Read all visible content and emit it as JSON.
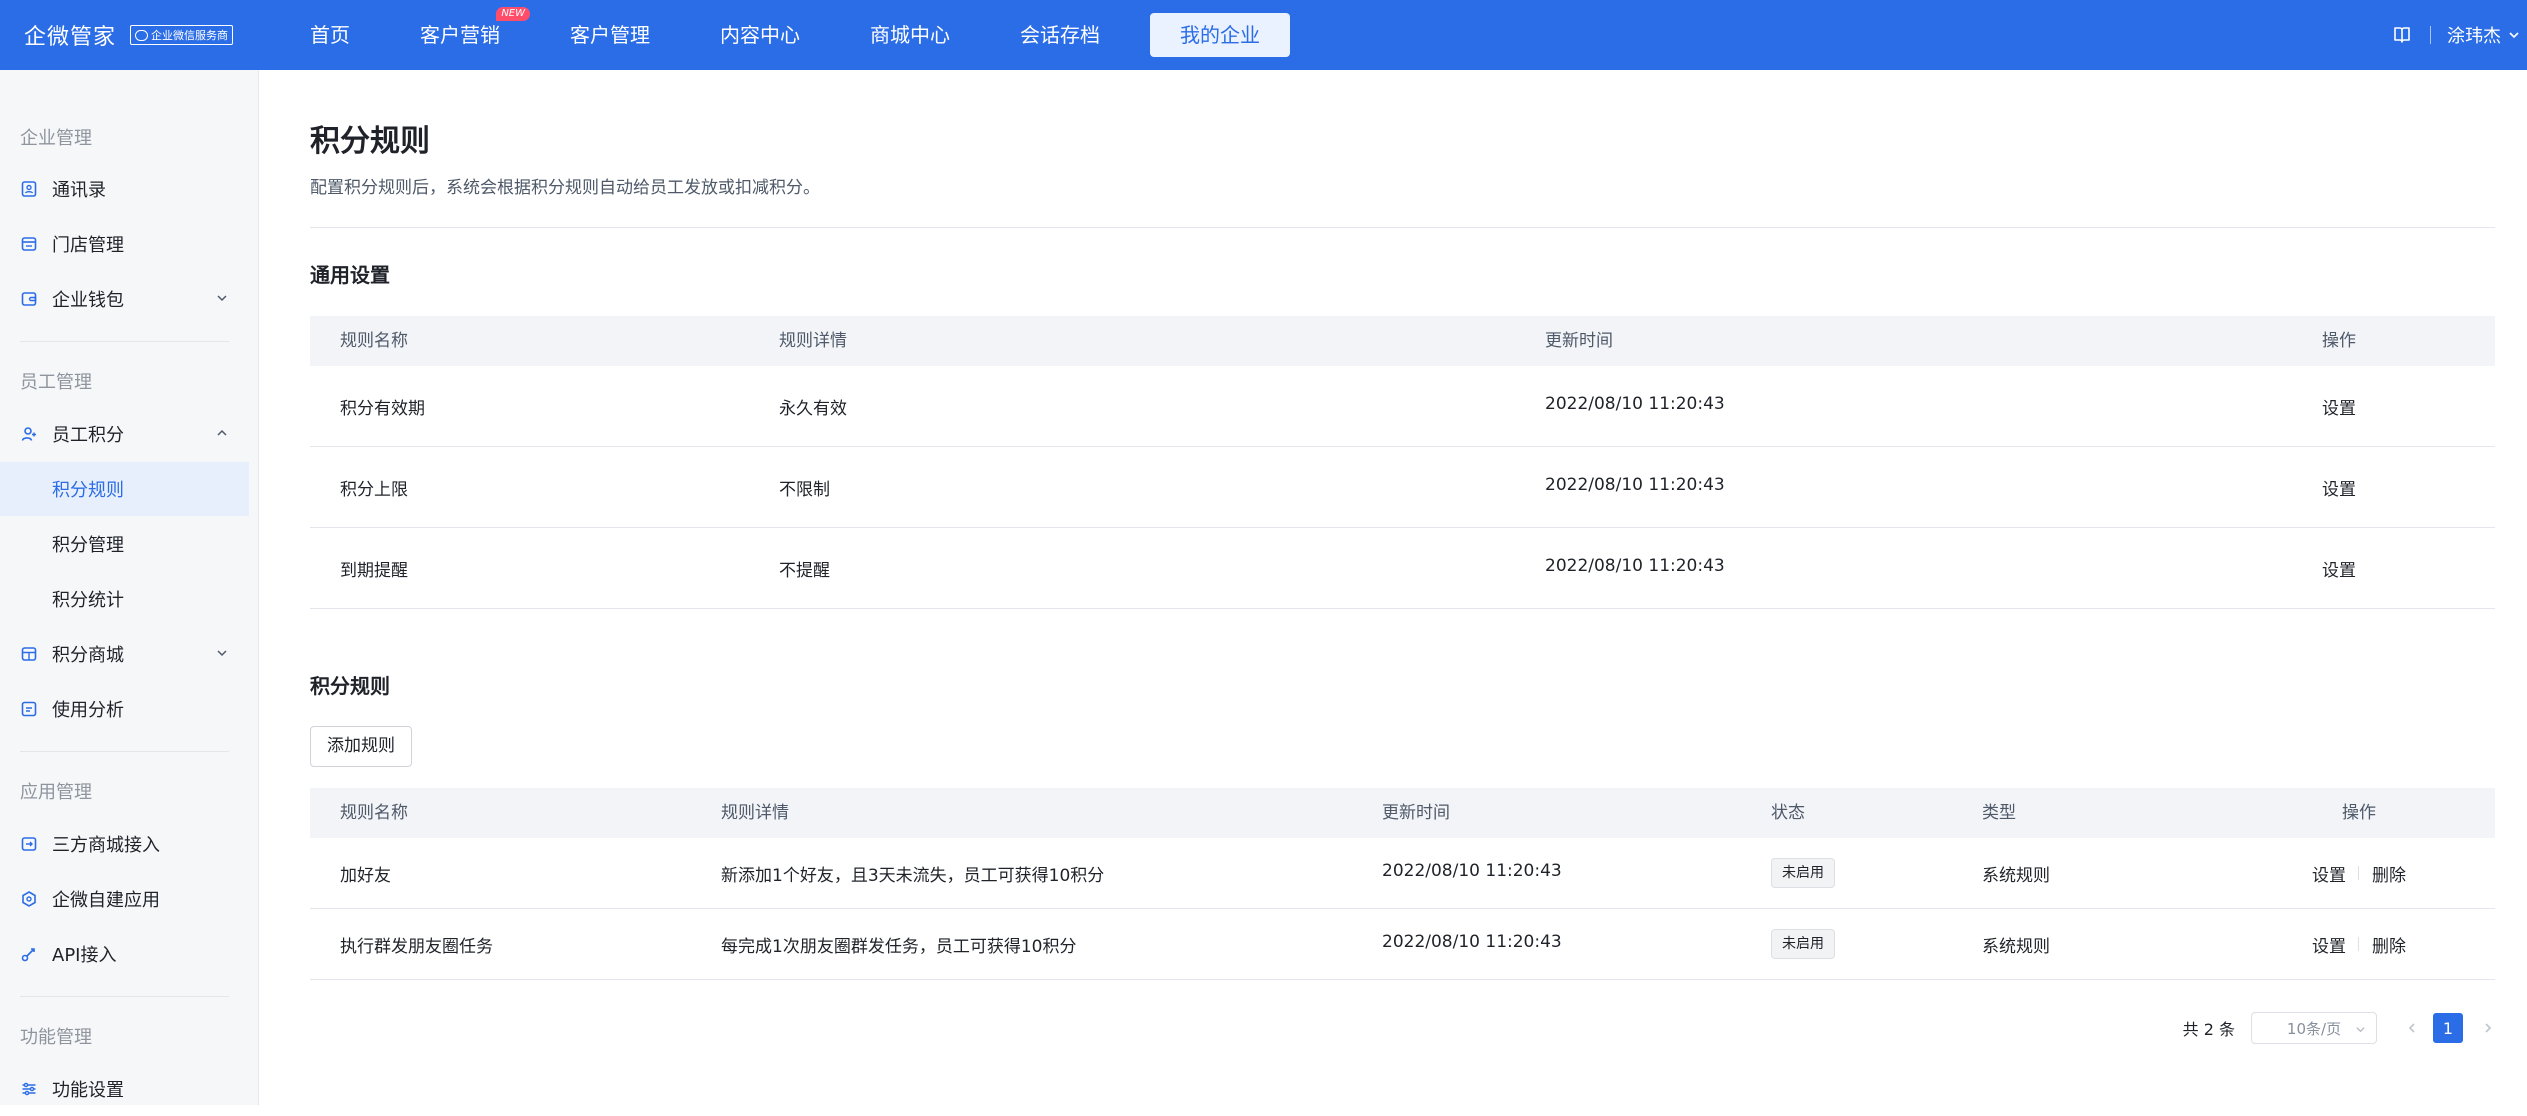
{
  "brand": {
    "name": "企微管家",
    "badge": "企业微信服务商"
  },
  "nav": [
    {
      "label": "首页"
    },
    {
      "label": "客户营销",
      "badge": "NEW"
    },
    {
      "label": "客户管理"
    },
    {
      "label": "内容中心"
    },
    {
      "label": "商城中心"
    },
    {
      "label": "会话存档"
    },
    {
      "label": "我的企业",
      "active": true
    }
  ],
  "user": {
    "name": "涂玮杰"
  },
  "sidebar": {
    "groups": [
      "企业管理",
      "员工管理",
      "应用管理",
      "功能管理"
    ],
    "items": {
      "contacts": "通讯录",
      "stores": "门店管理",
      "wallet": "企业钱包",
      "points": "员工积分",
      "points_rules": "积分规则",
      "points_manage": "积分管理",
      "points_stats": "积分统计",
      "points_mall": "积分商城",
      "usage": "使用分析",
      "third_mall": "三方商城接入",
      "self_app": "企微自建应用",
      "api": "API接入",
      "feature_settings": "功能设置"
    }
  },
  "page": {
    "title": "积分规则",
    "description": "配置积分规则后，系统会根据积分规则自动给员工发放或扣减积分。"
  },
  "general": {
    "title": "通用设置",
    "headers": [
      "规则名称",
      "规则详情",
      "更新时间",
      "操作"
    ],
    "rows": [
      {
        "name": "积分有效期",
        "detail": "永久有效",
        "time": "2022/08/10 11:20:43",
        "action": "设置"
      },
      {
        "name": "积分上限",
        "detail": "不限制",
        "time": "2022/08/10 11:20:43",
        "action": "设置"
      },
      {
        "name": "到期提醒",
        "detail": "不提醒",
        "time": "2022/08/10 11:20:43",
        "action": "设置"
      }
    ]
  },
  "rules": {
    "title": "积分规则",
    "add_button": "添加规则",
    "headers": [
      "规则名称",
      "规则详情",
      "更新时间",
      "状态",
      "类型",
      "操作"
    ],
    "rows": [
      {
        "name": "加好友",
        "detail": "新添加1个好友，且3天未流失，员工可获得10积分",
        "time": "2022/08/10 11:20:43",
        "status": "未启用",
        "type": "系统规则",
        "action_set": "设置",
        "action_delete": "删除"
      },
      {
        "name": "执行群发朋友圈任务",
        "detail": "每完成1次朋友圈群发任务，员工可获得10积分",
        "time": "2022/08/10 11:20:43",
        "status": "未启用",
        "type": "系统规则",
        "action_set": "设置",
        "action_delete": "删除"
      }
    ]
  },
  "pagination": {
    "total": "共 2 条",
    "page_size": "10条/页",
    "current": "1"
  },
  "colors": {
    "primary": "#2b6de6",
    "new_badge": "#ff4d6a"
  }
}
